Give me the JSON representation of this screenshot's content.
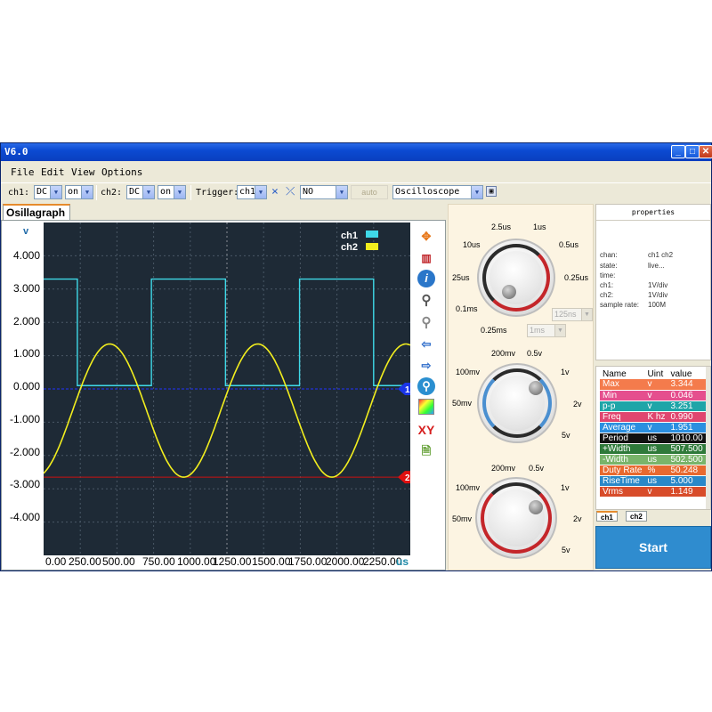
{
  "window": {
    "title": "V6.0",
    "buttons": [
      "_",
      "□",
      "✕"
    ]
  },
  "menu": [
    "File",
    "Edit",
    "View",
    "Options"
  ],
  "toolbar": {
    "ch1_label": "ch1:",
    "ch1_coupling": "DC",
    "ch1_state": "on",
    "ch2_label": "ch2:",
    "ch2_coupling": "DC",
    "ch2_state": "on",
    "trigger_label": "Trigger:",
    "trigger_source": "ch1",
    "trigger_mode": "NO",
    "auto_label": "auto",
    "mode": "Oscilloscope"
  },
  "tab": {
    "label": "Osillagraph"
  },
  "scope": {
    "y_unit": "v",
    "y_ticks": [
      "4.000",
      "3.000",
      "2.000",
      "1.000",
      "0.000",
      "-1.000",
      "-2.000",
      "-3.000",
      "-4.000"
    ],
    "x_ticks": [
      "0.00",
      "250.00",
      "500.00",
      "750.00",
      "1000.00",
      "1250.00",
      "1500.00",
      "1750.00",
      "2000.00",
      "2250.00"
    ],
    "x_unit": "us",
    "legend": [
      {
        "name": "ch1",
        "color": "#3fd9e8"
      },
      {
        "name": "ch2",
        "color": "#f2ee1e"
      }
    ],
    "markers": [
      "1",
      "2"
    ],
    "tool_icons": [
      "move-icon",
      "ruler-icon",
      "info-icon",
      "zoom-in-icon",
      "zoom-out-icon",
      "arrow-left-icon",
      "arrow-right-icon",
      "zoom-fit-icon",
      "color-icon",
      "xy-icon",
      "export-icon"
    ],
    "xy_label": "XY"
  },
  "chart_data": {
    "type": "line",
    "y_unit": "v",
    "x_unit": "us",
    "xlim": [
      0,
      2500
    ],
    "ylim": [
      -5,
      5
    ],
    "grid": true,
    "legend_position": "top-right",
    "series": [
      {
        "name": "ch1",
        "color": "#3fd9e8",
        "shape": "square",
        "period": 1010,
        "high": 3.3,
        "low": 0.1,
        "first_fall": 230,
        "duty_rate": 50.248
      },
      {
        "name": "ch2",
        "color": "#f2ee1e",
        "shape": "sine",
        "period": 1010,
        "amplitude": 2.0,
        "offset": -0.65,
        "first_peak": 450
      }
    ],
    "h_lines": [
      {
        "channel": "1",
        "y": 0.0,
        "color": "#2233ff"
      },
      {
        "channel": "2",
        "y": -2.65,
        "color": "#cc1111"
      }
    ]
  },
  "timebase": {
    "labels": [
      "2.5us",
      "1us",
      "10us",
      "0.5us",
      "25us",
      "0.25us",
      "0.1ms",
      "0.25ms"
    ],
    "sample_select": "125ns",
    "time_select": "1ms"
  },
  "volt1": {
    "labels": [
      "200mv",
      "0.5v",
      "100mv",
      "1v",
      "50mv",
      "2v",
      "5v"
    ]
  },
  "volt2": {
    "labels": [
      "200mv",
      "0.5v",
      "100mv",
      "1v",
      "50mv",
      "2v",
      "5v"
    ]
  },
  "properties": {
    "header": "properties",
    "rows": [
      {
        "key": "chan:",
        "value": "ch1 ch2"
      },
      {
        "key": "state:",
        "value": "live..."
      },
      {
        "key": "time:",
        "value": ""
      },
      {
        "key": "ch1:",
        "value": "1V/div"
      },
      {
        "key": "ch2:",
        "value": "1V/div"
      },
      {
        "key": "sample rate:",
        "value": "100M"
      }
    ]
  },
  "measurements": {
    "headers": [
      "Name",
      "Uint",
      "value"
    ],
    "rows": [
      {
        "name": "Max",
        "unit": "v",
        "value": "3.344",
        "color": "#f47b4c"
      },
      {
        "name": "Min",
        "unit": "v",
        "value": "0.046",
        "color": "#e54f8e"
      },
      {
        "name": "p-p",
        "unit": "v",
        "value": "3.251",
        "color": "#1fa5a8"
      },
      {
        "name": "Freq",
        "unit": "K hz",
        "value": "0.990",
        "color": "#e0466f"
      },
      {
        "name": "Average",
        "unit": "v",
        "value": "1.951",
        "color": "#2b8fe0"
      },
      {
        "name": "Period",
        "unit": "us",
        "value": "1010.00",
        "color": "#111111"
      },
      {
        "name": "+Width",
        "unit": "us",
        "value": "507.500",
        "color": "#2f7a3a"
      },
      {
        "name": "-Width",
        "unit": "us",
        "value": "502.500",
        "color": "#79b46a"
      },
      {
        "name": "Duty Rate",
        "unit": "%",
        "value": "50.248",
        "color": "#e8692f"
      },
      {
        "name": "RiseTime",
        "unit": "us",
        "value": "5.000",
        "color": "#2a88c8"
      },
      {
        "name": "Vrms",
        "unit": "v",
        "value": "1.149",
        "color": "#d84c2a"
      }
    ],
    "tabs": [
      "ch1",
      "ch2"
    ]
  },
  "start_label": "Start"
}
